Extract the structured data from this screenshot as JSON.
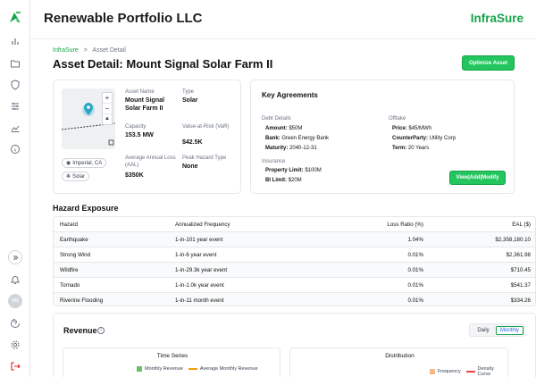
{
  "header": {
    "company": "Renewable Portfolio LLC",
    "brand": "InfraSure"
  },
  "breadcrumb": {
    "root": "InfraSure",
    "separator": ">",
    "current": "Asset Detail"
  },
  "page_title": "Asset Detail: Mount Signal Solar Farm II",
  "optimize_label": "Optimize Asset",
  "sidebar": {
    "icons": [
      "bar-chart-icon",
      "folder-icon",
      "shield-icon",
      "sliders-icon",
      "line-chart-icon",
      "info-icon"
    ],
    "bottom": [
      "expand-icon",
      "bell-icon",
      "help-icon",
      "settings-icon",
      "logout-icon"
    ],
    "avatar": "VK"
  },
  "asset": {
    "location_chip": "Imperial, CA",
    "type_chip": "Solar",
    "name_label": "Asset Name",
    "name": "Mount Signal Solar Farm II",
    "type_label": "Type",
    "type": "Solar",
    "capacity_label": "Capacity",
    "capacity": "153.5 MW",
    "var_label": "Value-at-Risk (VaR)",
    "var": "$42.5K",
    "aal_label": "Average Annual Loss (AAL)",
    "aal": "$350K",
    "peak_label": "Peak Hazard Type",
    "peak": "None"
  },
  "agreements": {
    "title": "Key Agreements",
    "debt_title": "Debt Details",
    "amount_k": "Amount:",
    "amount_v": "$50M",
    "bank_k": "Bank:",
    "bank_v": "Green Energy Bank",
    "maturity_k": "Maturity:",
    "maturity_v": "2040-12-31",
    "offtake_title": "Offtake",
    "price_k": "Price:",
    "price_v": "$45/MWh",
    "cp_k": "CounterParty:",
    "cp_v": "Utility Corp",
    "term_k": "Term:",
    "term_v": "20 Years",
    "ins_title": "Insurance",
    "prop_k": "Property Limit:",
    "prop_v": "$100M",
    "bi_k": "BI Limit:",
    "bi_v": "$20M",
    "button": "View|Add|Modify"
  },
  "hazard": {
    "title": "Hazard Exposure",
    "headers": [
      "Hazard",
      "Annualized Frequency",
      "Loss Ratio (%)",
      "EAL ($)"
    ],
    "rows": [
      [
        "Earthquake",
        "1-in-101 year event",
        "1.04%",
        "$2,358,180.10"
      ],
      [
        "Strong Wind",
        "1-in-6 year event",
        "0.01%",
        "$2,361.98"
      ],
      [
        "Wildfire",
        "1-in-29.3k year event",
        "0.01%",
        "$710.45"
      ],
      [
        "Tornado",
        "1-in-1.0k year event",
        "0.01%",
        "$541.37"
      ],
      [
        "Riverine Flooding",
        "1-in-11 month event",
        "0.01%",
        "$334.26"
      ]
    ]
  },
  "revenue": {
    "title": "Revenue",
    "toggle": [
      "Daily",
      "Monthly"
    ],
    "selected": "Monthly",
    "ts_title": "Time Series",
    "ts_legend": [
      "Monthly Revenue",
      "Average Monthly Revenue"
    ],
    "dist_title": "Distribution",
    "dist_legend": [
      "Frequency",
      "Density Curve"
    ],
    "colors": {
      "bar": "#6abf69",
      "avg": "#f59e0b",
      "freq": "#f6b98a",
      "density": "#ef4444"
    }
  },
  "colors": {
    "accent": "#16a34a",
    "button": "#22c55e"
  }
}
